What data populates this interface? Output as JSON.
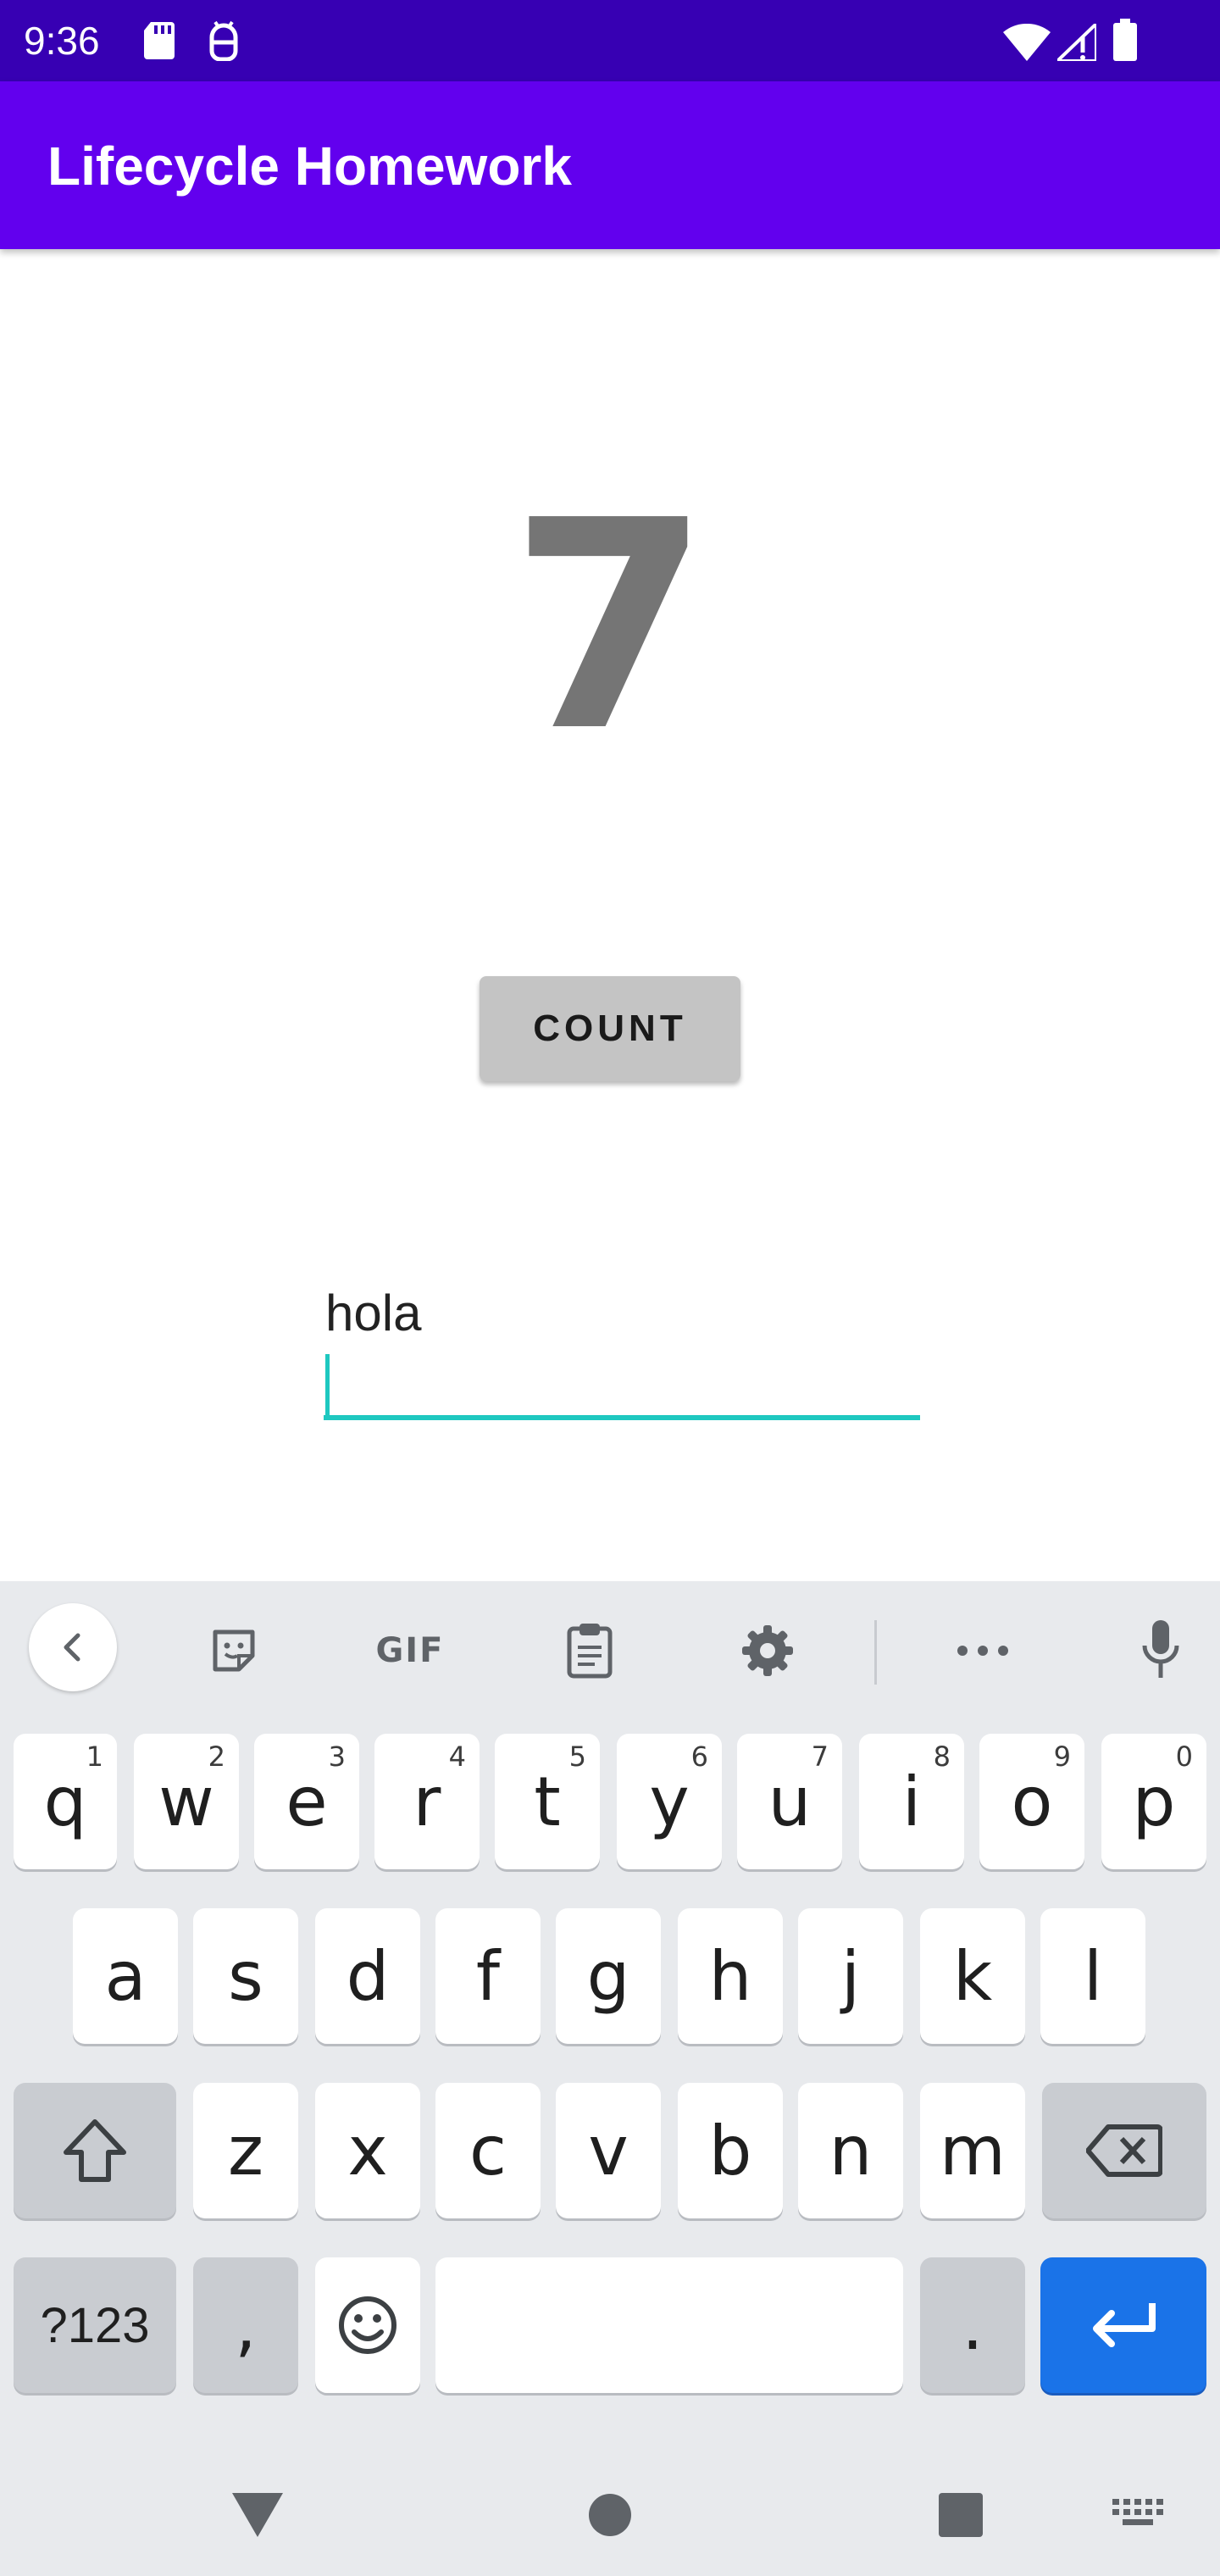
{
  "status_bar": {
    "time": "9:36",
    "icons": [
      "sd-card-icon",
      "android-debug-icon",
      "wifi-icon",
      "signal-icon",
      "battery-icon"
    ]
  },
  "app_bar": {
    "title": "Lifecycle Homework"
  },
  "main": {
    "count_value": "7",
    "count_button_label": "COUNT",
    "text_field_value": "hola"
  },
  "keyboard": {
    "toolbar": [
      "back-chevron-icon",
      "sticker-icon",
      "GIF",
      "clipboard-icon",
      "settings-gear-icon",
      "more-dots-icon",
      "microphone-icon"
    ],
    "gif_label": "GIF",
    "row1": [
      {
        "key": "q",
        "hint": "1"
      },
      {
        "key": "w",
        "hint": "2"
      },
      {
        "key": "e",
        "hint": "3"
      },
      {
        "key": "r",
        "hint": "4"
      },
      {
        "key": "t",
        "hint": "5"
      },
      {
        "key": "y",
        "hint": "6"
      },
      {
        "key": "u",
        "hint": "7"
      },
      {
        "key": "i",
        "hint": "8"
      },
      {
        "key": "o",
        "hint": "9"
      },
      {
        "key": "p",
        "hint": "0"
      }
    ],
    "row2": [
      "a",
      "s",
      "d",
      "f",
      "g",
      "h",
      "j",
      "k",
      "l"
    ],
    "row3": [
      "z",
      "x",
      "c",
      "v",
      "b",
      "n",
      "m"
    ],
    "symbols_label": "?123",
    "comma_label": ",",
    "period_label": ".",
    "colors": {
      "background": "#e8eaed",
      "enter": "#1a73e8",
      "accent": "#1ec8c0"
    }
  },
  "navigation": [
    "back-triangle-icon",
    "home-circle-icon",
    "recents-square-icon",
    "keyboard-switch-icon"
  ],
  "colors": {
    "status_bar": "#3700b3",
    "app_bar": "#6200ee"
  }
}
